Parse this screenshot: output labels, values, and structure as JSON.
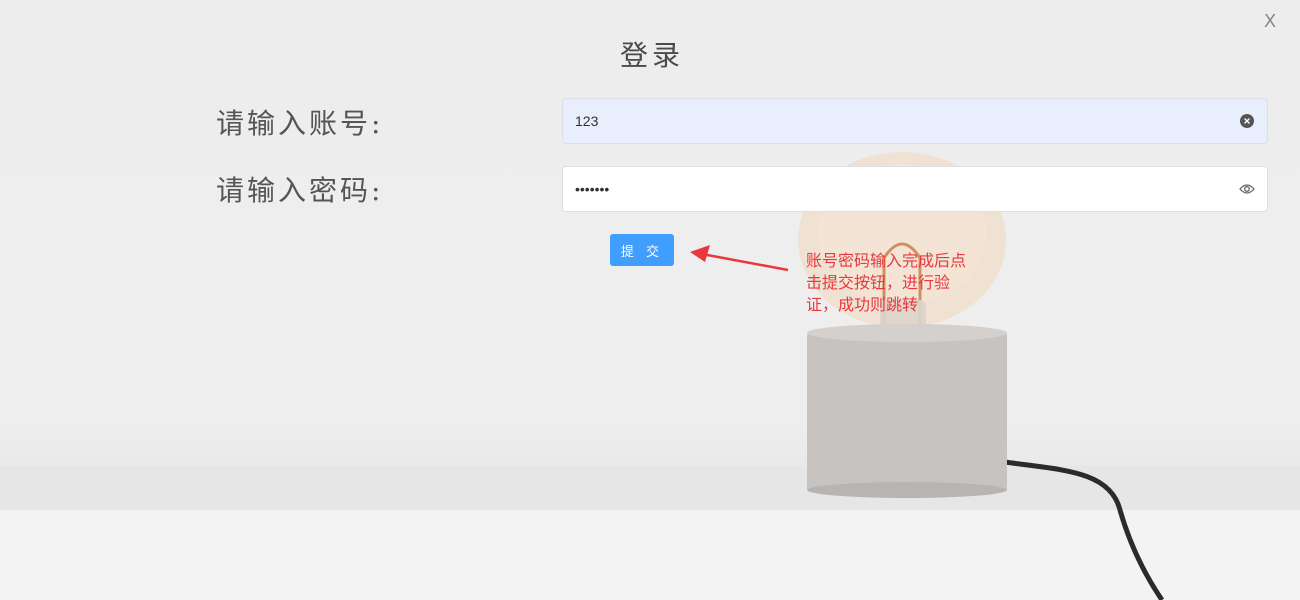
{
  "dialog": {
    "title": "登录",
    "close_label": "X"
  },
  "form": {
    "account_label": "请输入账号:",
    "account_value": "123",
    "account_clear_icon": "clear-circle-icon",
    "password_label": "请输入密码:",
    "password_value": "1234567",
    "password_toggle_icon": "eye-icon",
    "submit_label": "提 交"
  },
  "annotation": {
    "text": "账号密码输入完成后点击提交按钮，进行验证，成功则跳转",
    "color": "#e8383d"
  },
  "colors": {
    "primary": "#409eff",
    "autofill_bg": "#e8eefb"
  }
}
